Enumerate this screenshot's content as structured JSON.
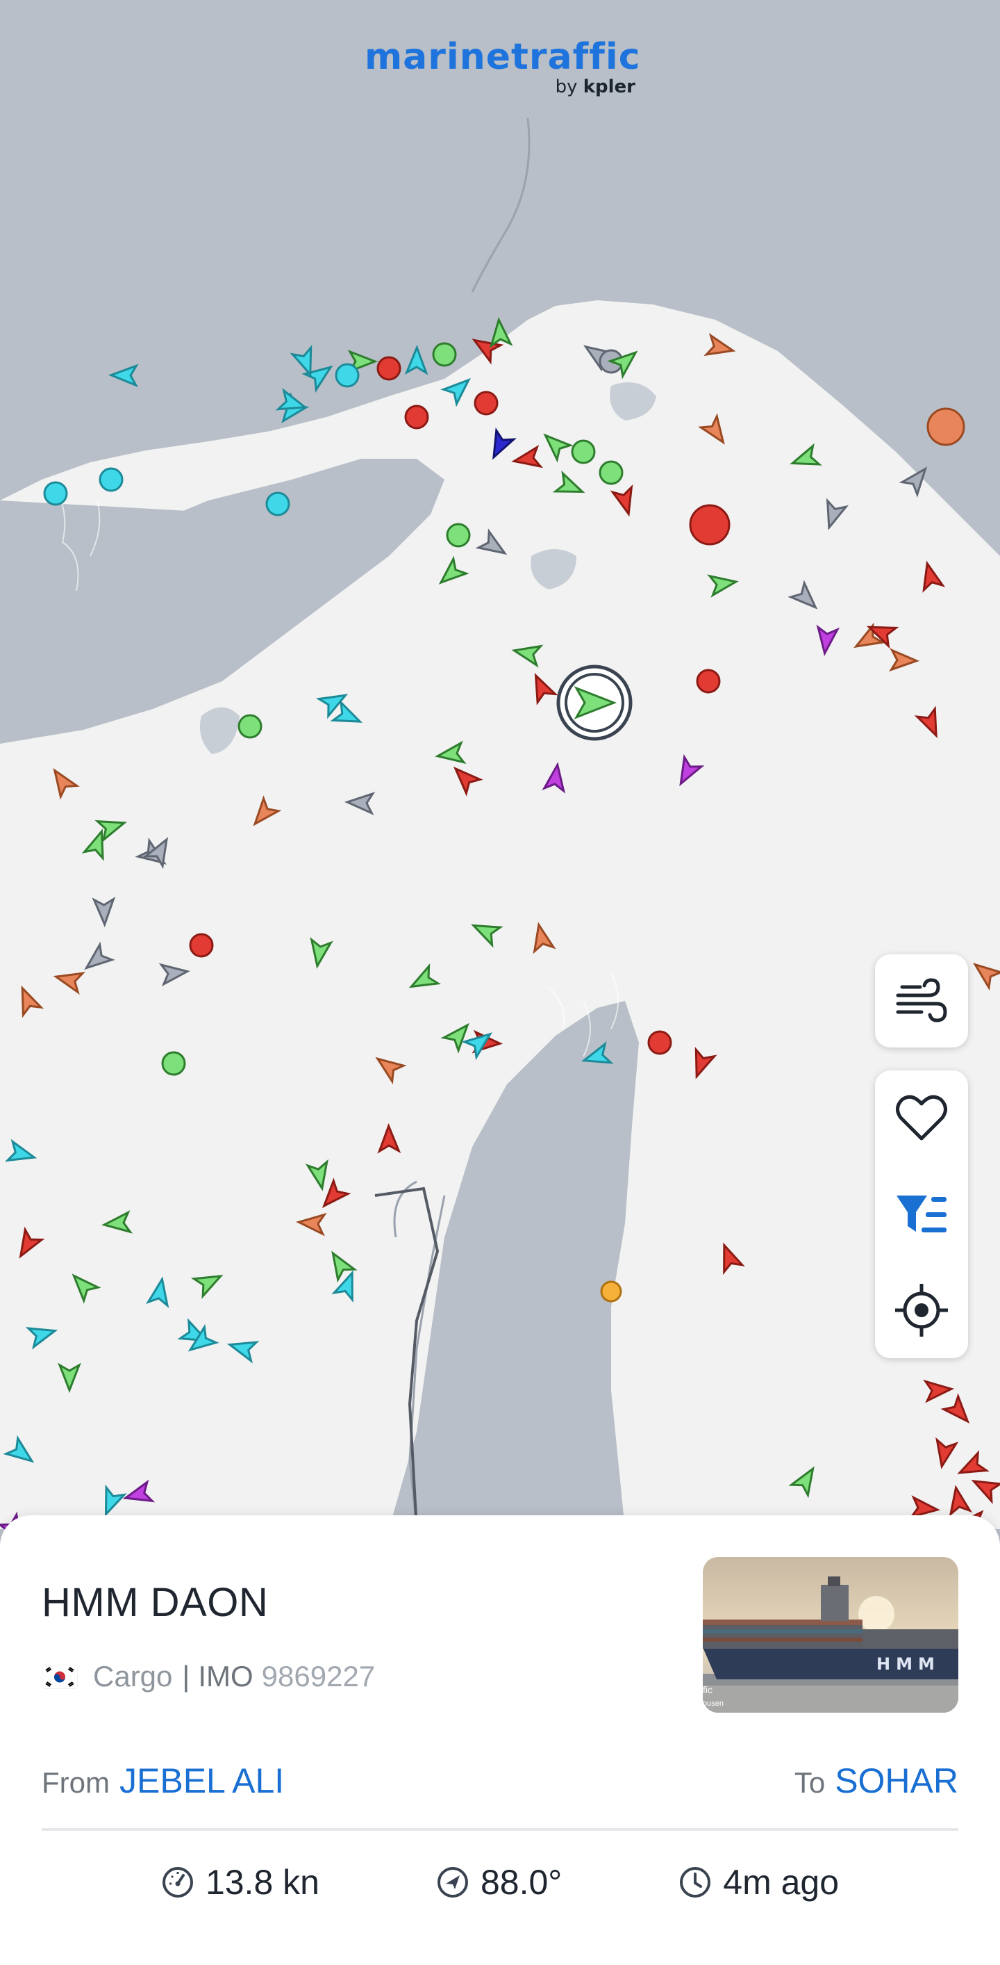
{
  "app": {
    "logo_main": "marinetraffic",
    "logo_by": "by",
    "logo_brand": "kpler"
  },
  "map_controls": [
    {
      "name": "weather-layer-button",
      "icon": "wind-icon"
    },
    {
      "name": "favorites-button",
      "icon": "heart-icon"
    },
    {
      "name": "filters-button",
      "icon": "filter-icon"
    },
    {
      "name": "my-location-button",
      "icon": "crosshair-icon"
    }
  ],
  "vessel": {
    "name": "HMM DAON",
    "flag_icon": "south-korea-flag-icon",
    "type": "Cargo",
    "separator": "|",
    "imo_label": "IMO",
    "imo": "9869227",
    "photo_icon": "container-ship-photo",
    "photo_text_1": "fic",
    "photo_text_2": "ousen",
    "photo_brand": "HMM"
  },
  "route": {
    "from_label": "From",
    "from_port": "JEBEL ALI",
    "to_label": "To",
    "to_port": "SOHAR"
  },
  "stats": {
    "speed": "13.8 kn",
    "course": "88.0°",
    "last_update": "4m ago"
  },
  "colors": {
    "brand": "#1e74dc",
    "sea": "#f2f2f2",
    "land": "#b8bfc8",
    "cargo": "#7ee07a",
    "tanker": "#e13b33",
    "passenger": "#3fd8e8",
    "tug": "#e8855a",
    "unknown": "#a9b0bb",
    "pleasure": "#c040e0",
    "hsc": "#2a2ad0",
    "fishing": "#f5b13a"
  }
}
